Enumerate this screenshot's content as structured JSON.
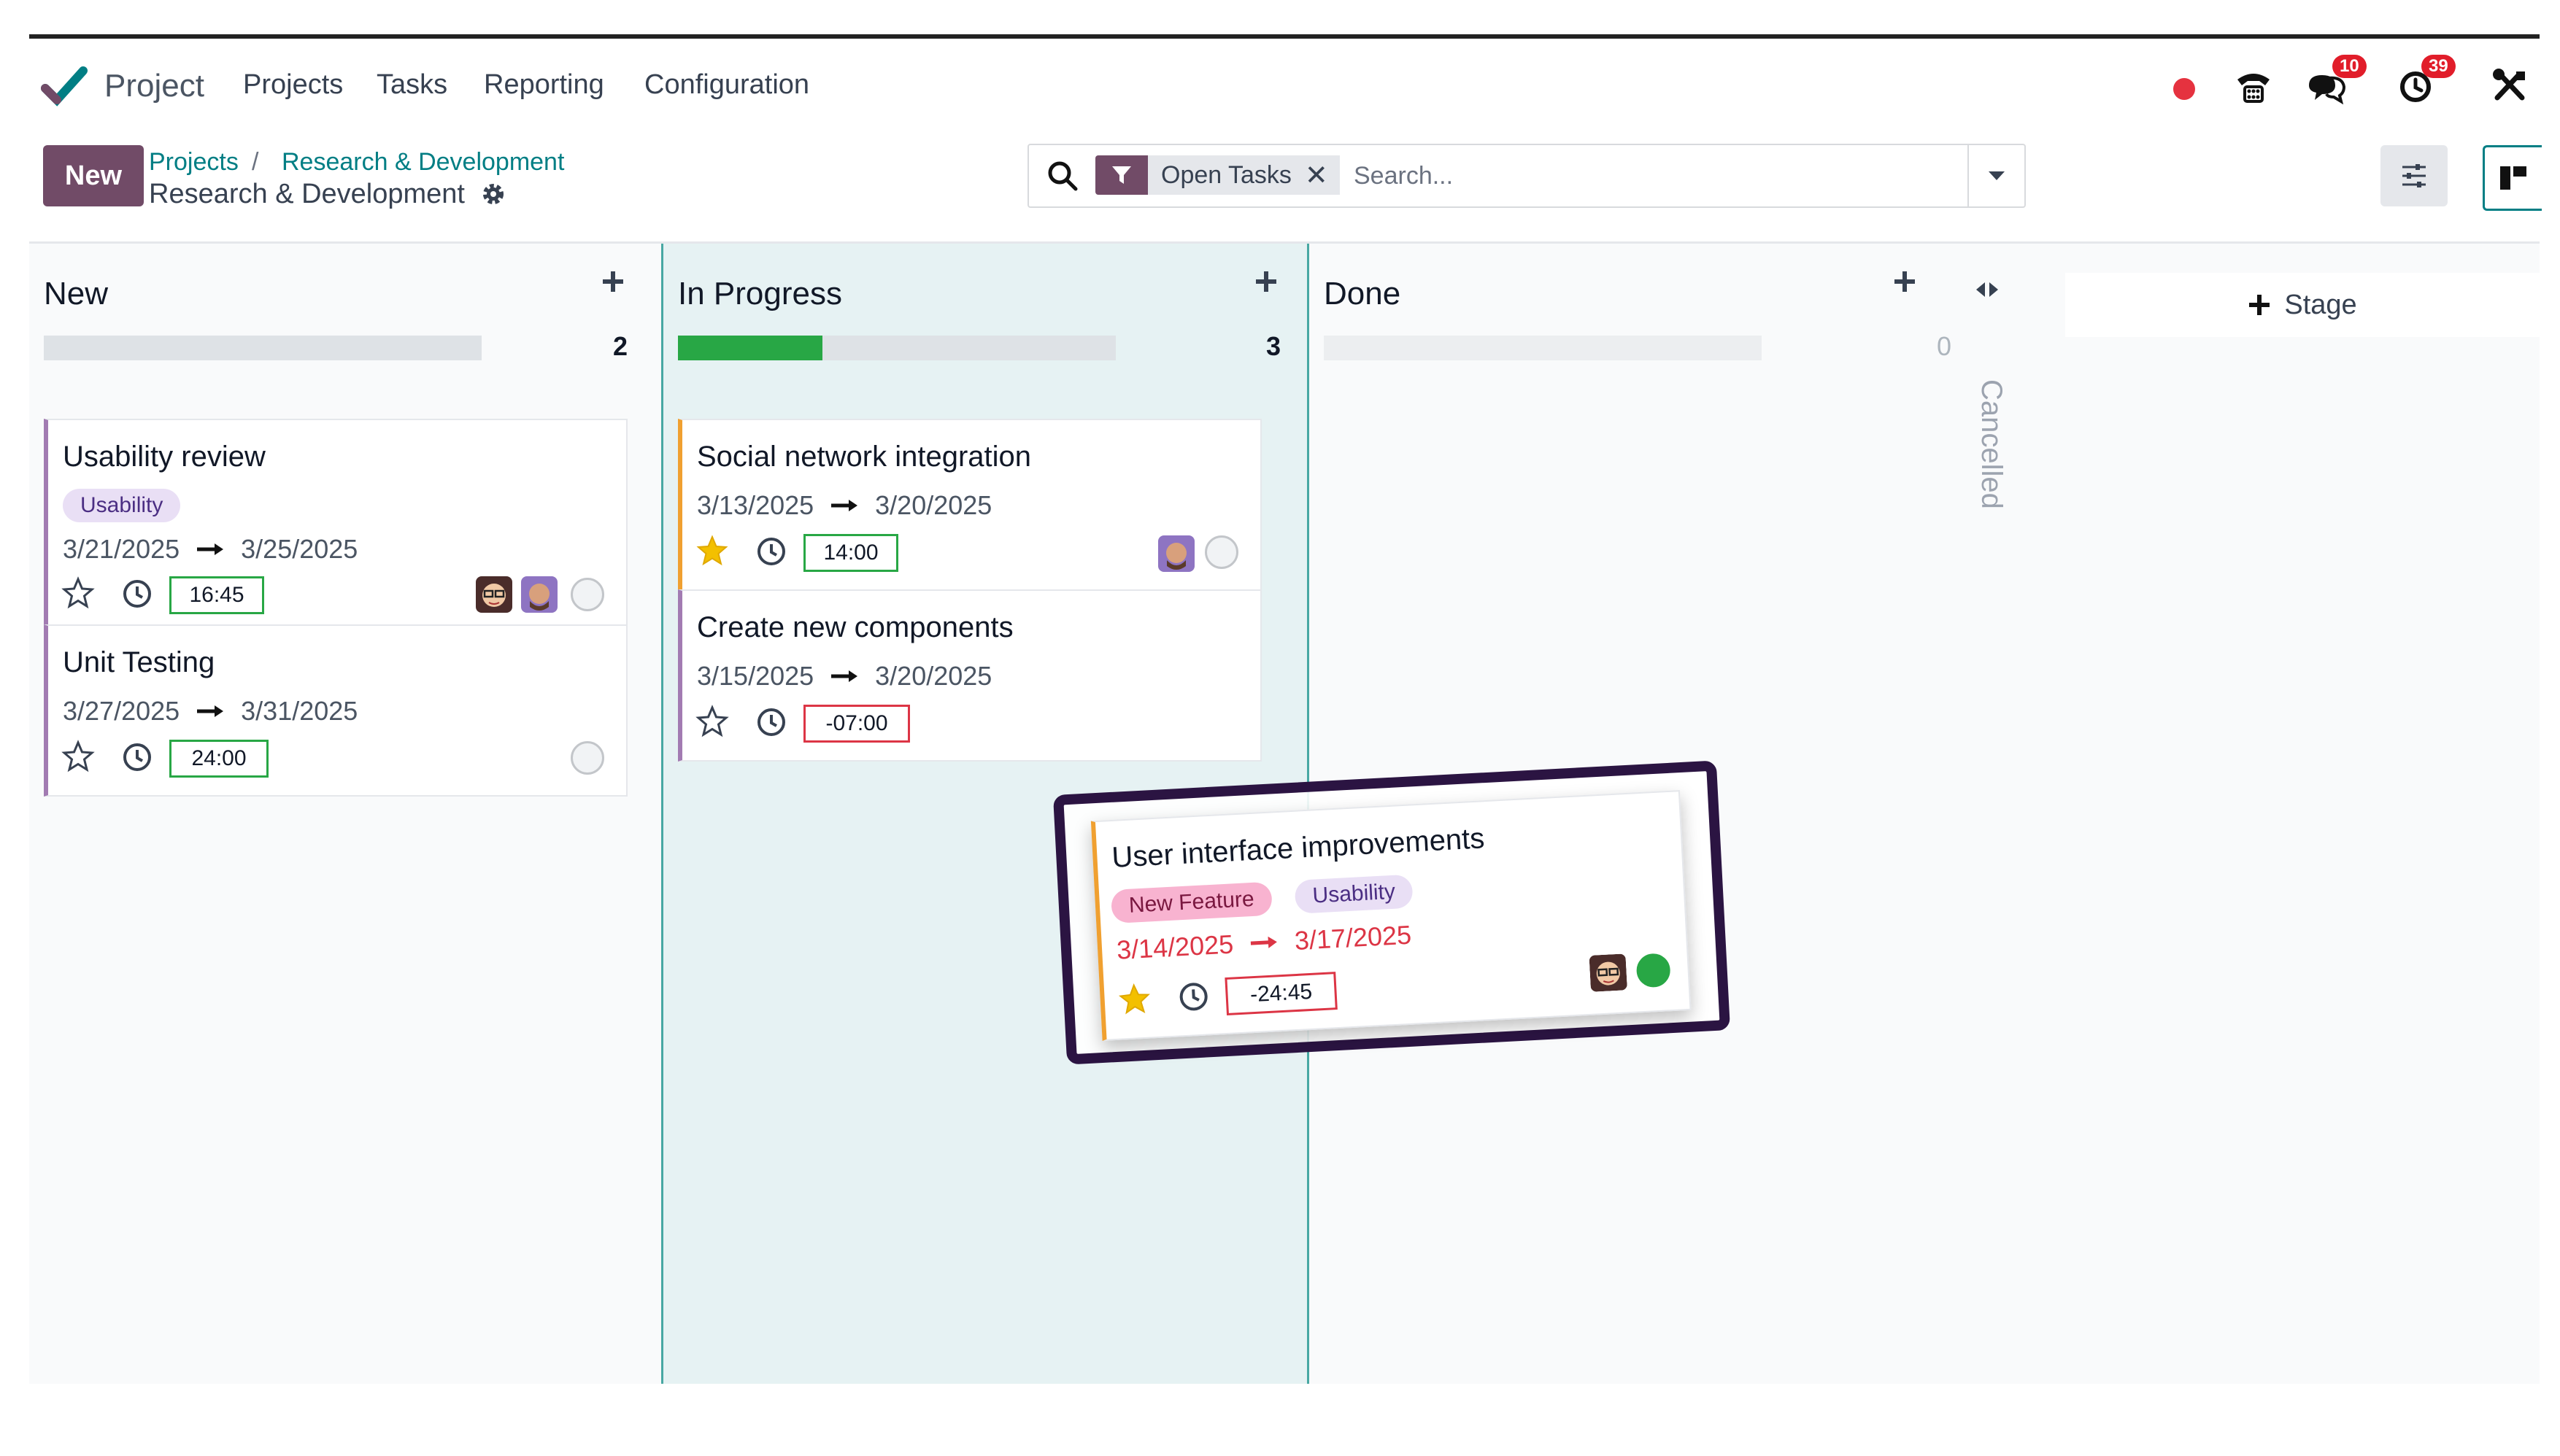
{
  "navbar": {
    "app_name": "Project",
    "menu": [
      "Projects",
      "Tasks",
      "Reporting",
      "Configuration"
    ],
    "messages_badge": "10",
    "activities_badge": "39"
  },
  "control": {
    "new_label": "New",
    "breadcrumb_parent": "Projects",
    "breadcrumb_sep": "/",
    "breadcrumb_project_link": "Research & Development",
    "breadcrumb_current": "Research & Development"
  },
  "search": {
    "facet_label": "Open Tasks",
    "placeholder": "Search..."
  },
  "columns": [
    {
      "title": "New",
      "count": "2",
      "progress": 0,
      "cards": [
        {
          "title": "Usability review",
          "tag": "Usability",
          "start": "3/21/2025",
          "end": "3/25/2025",
          "time": "16:45",
          "starred": false
        },
        {
          "title": "Unit Testing",
          "start": "3/27/2025",
          "end": "3/31/2025",
          "time": "24:00",
          "starred": false
        }
      ]
    },
    {
      "title": "In Progress",
      "count": "3",
      "progress": 0.33,
      "cards": [
        {
          "title": "Social network integration",
          "start": "3/13/2025",
          "end": "3/20/2025",
          "time": "14:00",
          "starred": true
        },
        {
          "title": "Create new components",
          "start": "3/15/2025",
          "end": "3/20/2025",
          "time": "-07:00",
          "starred": false
        }
      ]
    },
    {
      "title": "Done",
      "count": "0",
      "progress": 0
    }
  ],
  "folded_column": "Cancelled",
  "add_stage_label": "Stage",
  "dragged_card": {
    "title": "User interface improvements",
    "tags": [
      "New Feature",
      "Usability"
    ],
    "start": "3/14/2025",
    "end": "3/17/2025",
    "time": "-24:45",
    "starred": true
  },
  "colors": {
    "brand": "#714b67",
    "teal": "#017e84",
    "progress_green": "#28a745",
    "overdue_red": "#dc3545",
    "drag_border": "#2b1442"
  }
}
